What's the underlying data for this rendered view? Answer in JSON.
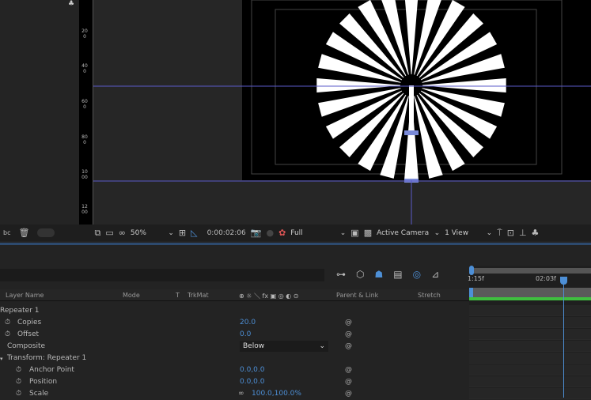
{
  "ruler": {
    "ticks": [
      "200",
      "400",
      "600",
      "800",
      "1000",
      "1200"
    ]
  },
  "viewer_footer": {
    "toolbar": {
      "magnification": "50%",
      "timecode": "0:00:02:06",
      "resolution": "Full",
      "camera": "Active Camera",
      "views": "1 View"
    }
  },
  "left_panel": {
    "bpc_label": "bc"
  },
  "timeline": {
    "ruler_labels": [
      "1:15f",
      "02:03f"
    ],
    "columns": {
      "layer_name": "Layer Name",
      "mode": "Mode",
      "t": "T",
      "trkmat": "TrkMat",
      "parent": "Parent & Link",
      "stretch": "Stretch",
      "switches": "⊕ ☼ ＼ fx ▣ ◎ ◐ ⊙"
    },
    "rows": [
      {
        "label": "Repeater 1",
        "value": ""
      },
      {
        "label": "Copies",
        "value": "20.0"
      },
      {
        "label": "Offset",
        "value": "0.0"
      },
      {
        "label": "Composite",
        "value": "Below"
      },
      {
        "label": "Transform: Repeater 1",
        "value": ""
      },
      {
        "label": "Anchor Point",
        "value": "0.0,0.0"
      },
      {
        "label": "Position",
        "value": "0.0,0.0"
      },
      {
        "label": "Scale",
        "value": "100.0,100.0%"
      }
    ]
  },
  "colors": {
    "accent": "#4d8fd6",
    "guide": "#5a5ac8",
    "work_area": "#3fbf3f"
  }
}
